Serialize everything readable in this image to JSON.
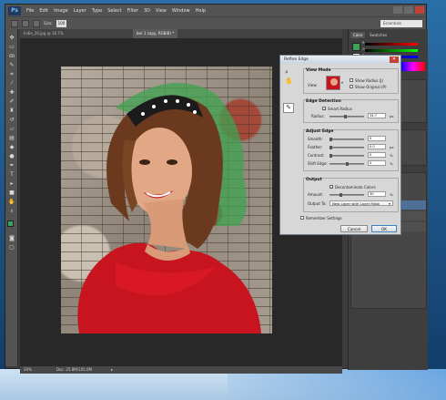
{
  "app": {
    "logo": "Ps",
    "menu": [
      "File",
      "Edit",
      "Image",
      "Layer",
      "Type",
      "Select",
      "Filter",
      "3D",
      "View",
      "Window",
      "Help"
    ],
    "workspace": "Essentials"
  },
  "options_bar": {
    "size_label": "Size:",
    "size_value": "100"
  },
  "doc_tabs": [
    {
      "label": "Indie_20.jpg @ 16.7%"
    },
    {
      "label": "ber 1 copy, RGB/8) *"
    }
  ],
  "status_bar": {
    "zoom": "20%",
    "doc_size": "Doc: 25.8M/105.0M"
  },
  "panels": {
    "tabs": [
      "Color",
      "Swatches"
    ],
    "color_values": [
      "R",
      "G",
      "B"
    ]
  },
  "refine_edge": {
    "title": "Refine Edge",
    "view_mode": {
      "title": "View Mode",
      "view_label": "View:",
      "show_radius": "Show Radius (J)",
      "show_original": "Show Original (P)"
    },
    "edge_detection": {
      "title": "Edge Detection",
      "smart_radius": "Smart Radius",
      "radius_label": "Radius:",
      "radius_value": "34.7",
      "radius_unit": "px",
      "radius_level": 0.45
    },
    "adjust_edge": {
      "title": "Adjust Edge",
      "rows": [
        {
          "label": "Smooth:",
          "value": "0",
          "unit": "",
          "level": 0.0
        },
        {
          "label": "Feather:",
          "value": "0.0",
          "unit": "px",
          "level": 0.0
        },
        {
          "label": "Contrast:",
          "value": "0",
          "unit": "%",
          "level": 0.0
        },
        {
          "label": "Shift Edge:",
          "value": "0",
          "unit": "%",
          "level": 0.5
        }
      ]
    },
    "output": {
      "title": "Output",
      "decontaminate": "Decontaminate Colors",
      "amount_label": "Amount:",
      "amount_value": "30",
      "amount_unit": "%",
      "amount_level": 0.3,
      "output_to_label": "Output To:",
      "output_to_value": "New Layer with Layer Mask"
    },
    "remember": "Remember Settings",
    "cancel": "Cancel",
    "ok": "OK"
  }
}
